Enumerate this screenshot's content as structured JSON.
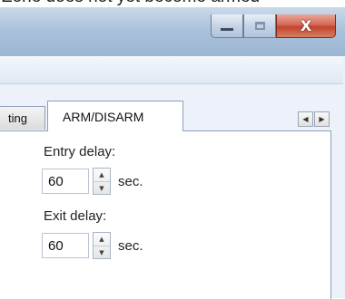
{
  "caption": "Zone does not yet become armed",
  "window_controls": {
    "minimize_icon": "minimize-icon",
    "maximize_icon": "maximize-icon",
    "close_icon": "close-icon",
    "close_glyph": "X"
  },
  "tabs": [
    {
      "label": "ting",
      "active": false
    },
    {
      "label": "ARM/DISARM",
      "active": true
    }
  ],
  "tab_scroll": {
    "left_glyph": "◀",
    "right_glyph": "▶"
  },
  "arm_disarm": {
    "entry_delay_label": "Entry delay:",
    "entry_delay_value": "60",
    "exit_delay_label": "Exit delay:",
    "exit_delay_value": "60",
    "unit": "sec."
  },
  "colors": {
    "title_bar": "#a9c0d9",
    "close_button": "#c2432c",
    "panel": "#ffffff"
  }
}
